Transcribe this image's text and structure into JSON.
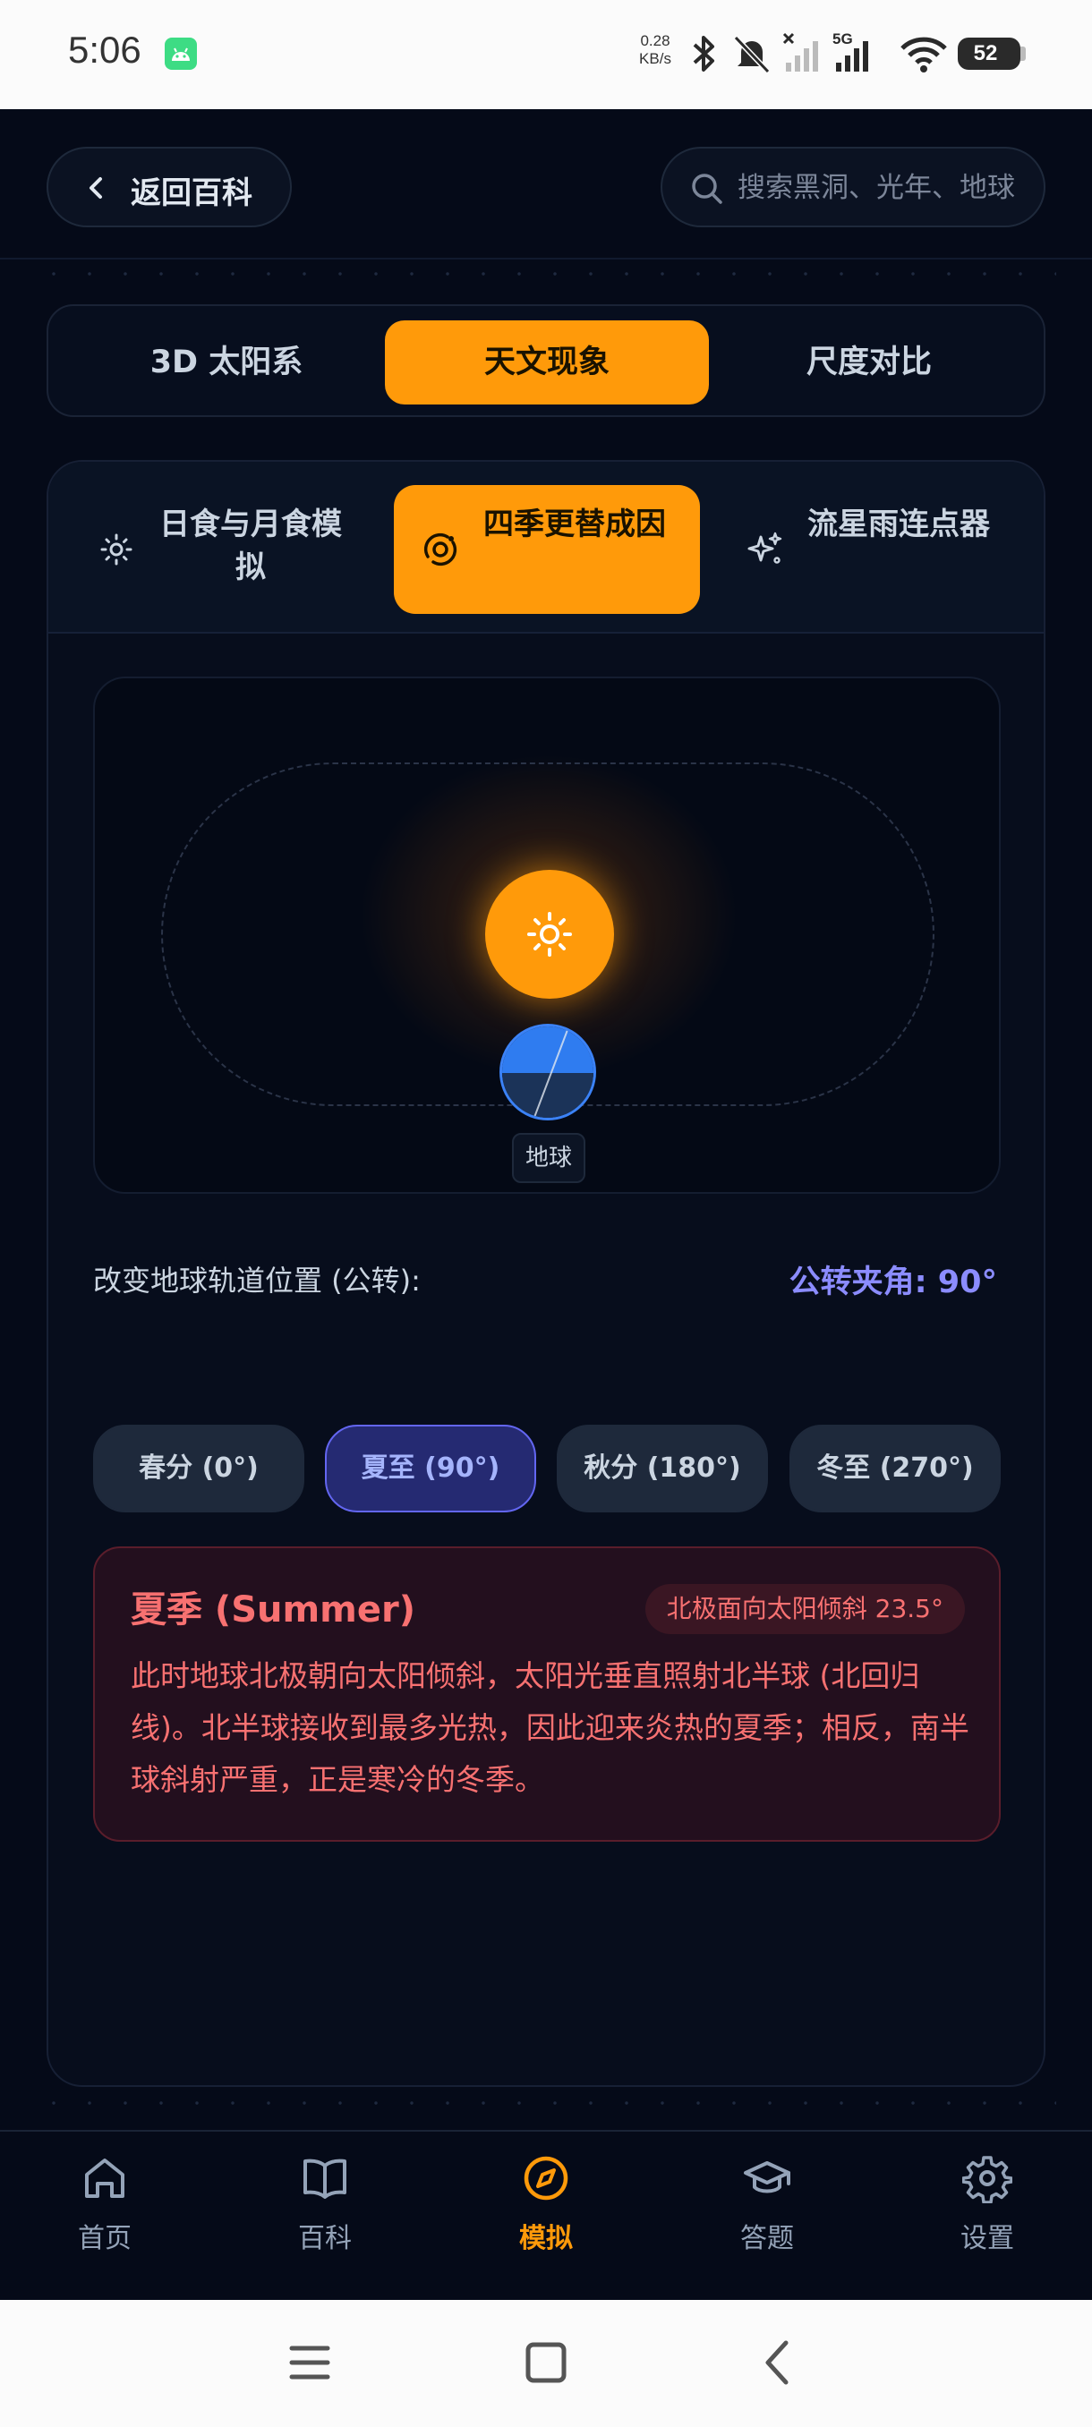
{
  "status_bar": {
    "time": "5:06",
    "net_speed_value": "0.28",
    "net_speed_unit": "KB/s",
    "network_type": "5G",
    "battery": "52"
  },
  "header": {
    "back_label": "返回百科",
    "search_placeholder": "搜索黑洞、光年、地球"
  },
  "main_tabs": [
    {
      "label": "3D 太阳系",
      "active": false
    },
    {
      "label": "天文现象",
      "active": true
    },
    {
      "label": "尺度对比",
      "active": false
    }
  ],
  "sub_tabs": [
    {
      "label": "日食与月食模拟",
      "icon": "sun-icon",
      "active": false
    },
    {
      "label": "四季更替成因",
      "icon": "orbit-icon",
      "active": true
    },
    {
      "label": "流星雨连点器",
      "icon": "sparkles-icon",
      "active": false
    }
  ],
  "simulation": {
    "earth_label": "地球"
  },
  "controls": {
    "label": "改变地球轨道位置 (公转):",
    "angle_readout": "公转夹角: 90°",
    "positions": [
      {
        "label": "春分 (0°)",
        "active": false
      },
      {
        "label": "夏至 (90°)",
        "active": true
      },
      {
        "label": "秋分 (180°)",
        "active": false
      },
      {
        "label": "冬至 (270°)",
        "active": false
      }
    ]
  },
  "season": {
    "title": "夏季 (Summer)",
    "tilt_badge": "北极面向太阳倾斜 23.5°",
    "description": "此时地球北极朝向太阳倾斜，太阳光垂直照射北半球 (北回归线)。北半球接收到最多光热，因此迎来炎热的夏季；相反，南半球斜射严重，正是寒冷的冬季。"
  },
  "bottom_nav": [
    {
      "label": "首页",
      "icon": "home-icon",
      "active": false
    },
    {
      "label": "百科",
      "icon": "book-icon",
      "active": false
    },
    {
      "label": "模拟",
      "icon": "compass-icon",
      "active": true
    },
    {
      "label": "答题",
      "icon": "graduation-cap-icon",
      "active": false
    },
    {
      "label": "设置",
      "icon": "gear-icon",
      "active": false
    }
  ],
  "colors": {
    "accent": "#ff9a0a",
    "background": "#050a18",
    "highlight": "#6366f1",
    "season_text": "#f87171"
  }
}
